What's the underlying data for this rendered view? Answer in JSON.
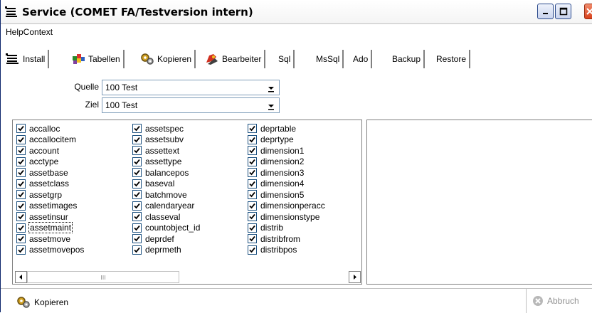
{
  "window": {
    "title": "Service (COMET FA/Testversion intern)",
    "icon": "service-icon"
  },
  "menu": {
    "items": [
      "HelpContext"
    ]
  },
  "tabs": [
    {
      "label": "Install",
      "icon": "install-icon"
    },
    {
      "label": "Tabellen",
      "icon": "tables-icon"
    },
    {
      "label": "Kopieren",
      "icon": "gears-icon"
    },
    {
      "label": "Bearbeiter",
      "icon": "editor-icon"
    },
    {
      "label": "Sql",
      "icon": ""
    },
    {
      "label": "MsSql",
      "icon": ""
    },
    {
      "label": "Ado",
      "icon": ""
    },
    {
      "label": "Backup",
      "icon": ""
    },
    {
      "label": "Restore",
      "icon": ""
    }
  ],
  "form": {
    "source_label": "Quelle",
    "source_value": "100 Test",
    "target_label": "Ziel",
    "target_value": "100 Test"
  },
  "tables": {
    "col1": [
      "accalloc",
      "accallocitem",
      "account",
      "acctype",
      "assetbase",
      "assetclass",
      "assetgrp",
      "assetimages",
      "assetinsur",
      "assetmaint",
      "assetmove",
      "assetmovepos"
    ],
    "col2": [
      "assetspec",
      "assetsubv",
      "assettext",
      "assettype",
      "balancepos",
      "baseval",
      "batchmove",
      "calendaryear",
      "classeval",
      "countobject_id",
      "deprdef",
      "deprmeth"
    ],
    "col3": [
      "deprtable",
      "deprtype",
      "dimension1",
      "dimension2",
      "dimension3",
      "dimension4",
      "dimension5",
      "dimensionperacc",
      "dimensionstype",
      "distrib",
      "distribfrom",
      "distribpos"
    ],
    "checked": true,
    "focused_item": "assetmaint"
  },
  "status": {
    "action_label": "Kopieren",
    "action_icon": "gears-icon",
    "cancel_label": "Abbruch",
    "cancel_icon": "cancel-icon"
  },
  "colors": {
    "titlebar_border": "#0a246a",
    "close_button": "#d8411b",
    "checkbox_border": "#1c5180",
    "disabled_text": "#909090"
  }
}
